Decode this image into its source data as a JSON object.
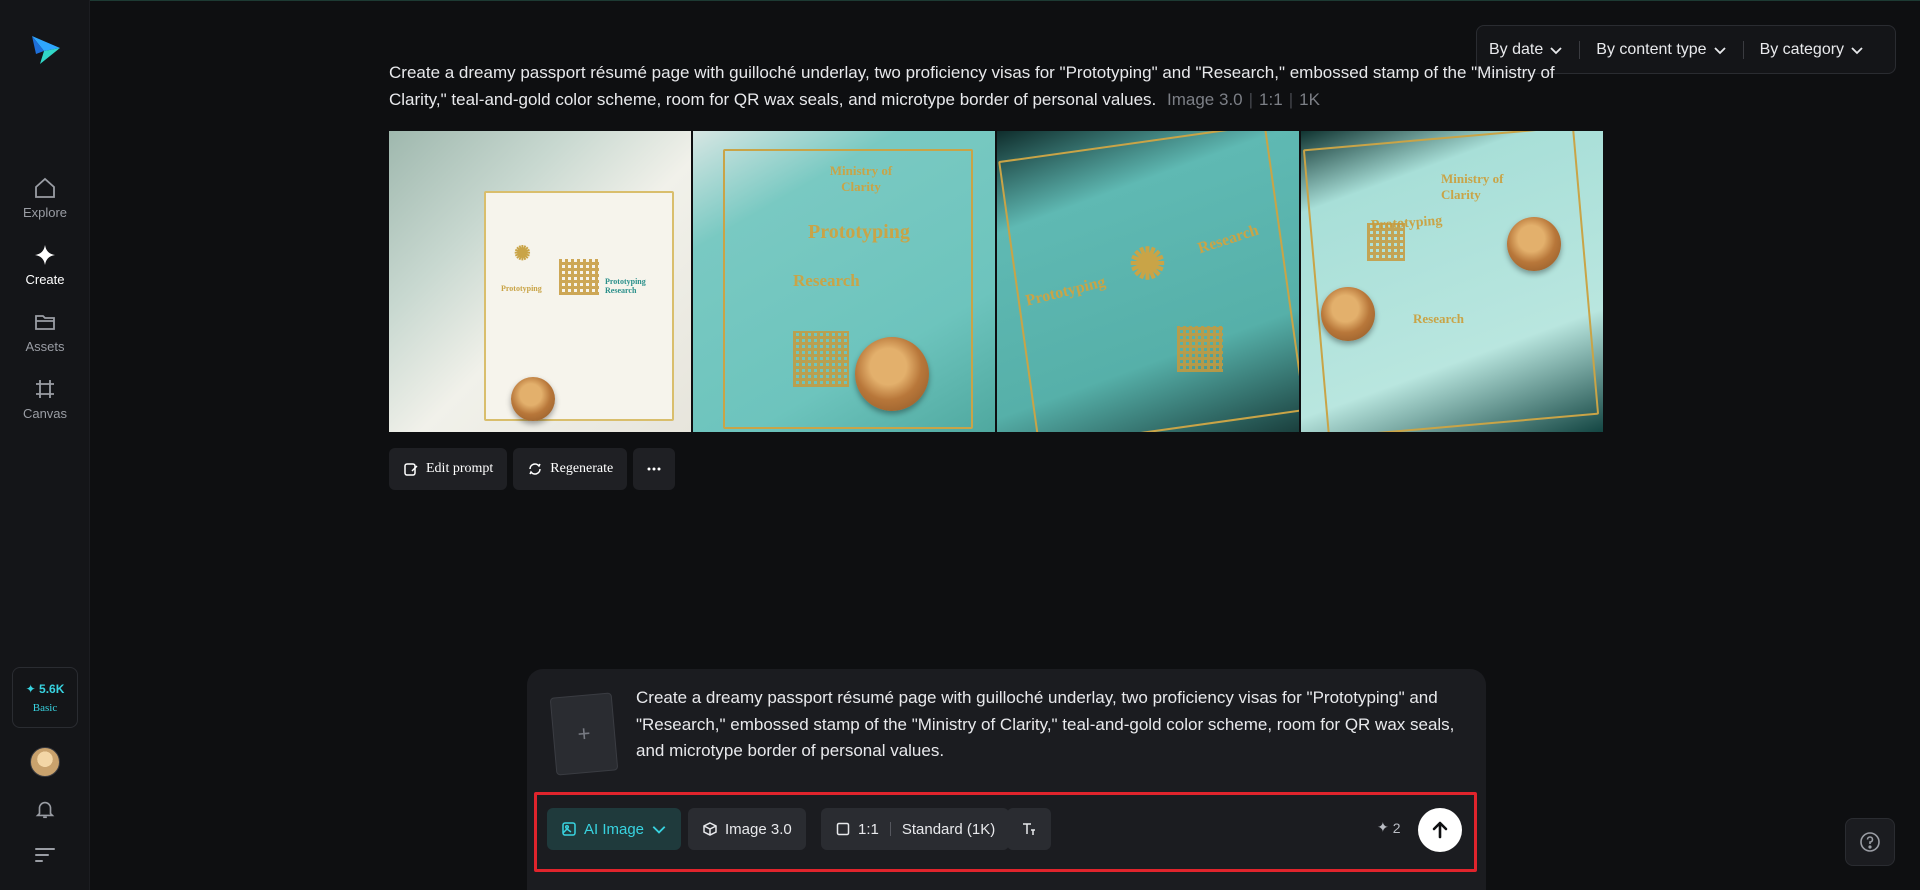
{
  "nav": {
    "items": [
      {
        "label": "Explore"
      },
      {
        "label": "Create"
      },
      {
        "label": "Assets"
      },
      {
        "label": "Canvas"
      }
    ],
    "credits": {
      "amount": "5.6K",
      "plan": "Basic"
    }
  },
  "filters": {
    "by_date": "By date",
    "by_content_type": "By content type",
    "by_category": "By category"
  },
  "generation": {
    "prompt": "Create a dreamy passport résumé page with guilloché underlay, two proficiency visas for \"Prototyping\" and \"Research,\" embossed stamp of the \"Ministry of Clarity,\" teal-and-gold color scheme, room for QR wax seals, and microtype border of personal values.",
    "model": "Image 3.0",
    "ratio": "1:1",
    "resolution": "1K",
    "images": [
      {
        "labels": [
          "Prototyping",
          "Prototyping Research"
        ]
      },
      {
        "labels": [
          "Ministry of Clarity",
          "Prototyping",
          "Research"
        ]
      },
      {
        "labels": [
          "Prototyping",
          "Research"
        ]
      },
      {
        "labels": [
          "Ministry of Clarity",
          "Prototyping",
          "Research"
        ]
      }
    ],
    "actions": {
      "edit_prompt": "Edit prompt",
      "regenerate": "Regenerate"
    }
  },
  "composer": {
    "ref_plus": "+",
    "prompt": "Create a dreamy passport résumé page with guilloché underlay, two proficiency visas for \"Prototyping\" and \"Research,\" embossed stamp of the \"Ministry of Clarity,\" teal-and-gold color scheme, room for QR wax seals, and microtype border of personal values.",
    "mode": "AI Image",
    "model": "Image 3.0",
    "ratio": "1:1",
    "quality": "Standard (1K)",
    "cost": "2"
  },
  "colors": {
    "accent": "#38d3e0",
    "highlight_border": "#e0242c",
    "background": "#0e0f11"
  }
}
